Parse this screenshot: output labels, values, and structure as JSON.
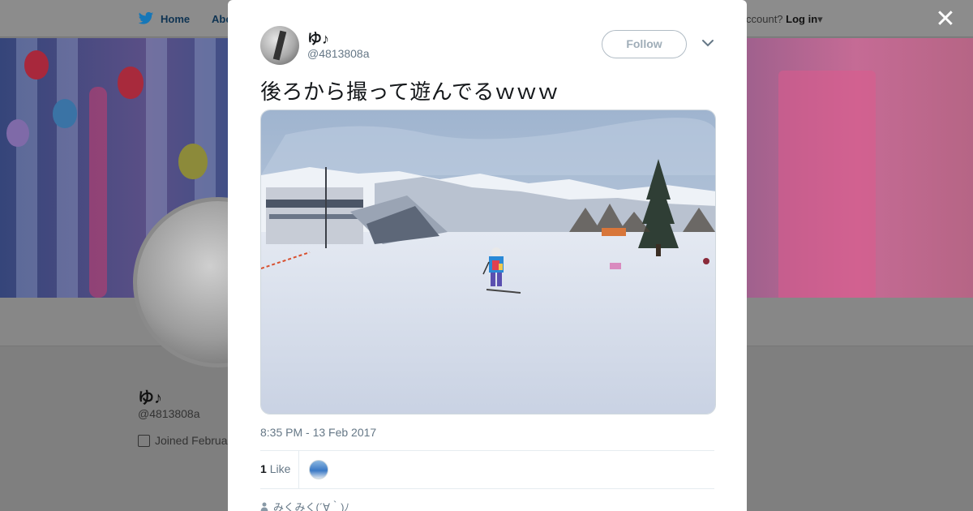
{
  "background": {
    "nav": {
      "home_label": "Home",
      "about_label": "Abo",
      "account_prefix": "ccount?",
      "login_label": "Log in"
    },
    "profile": {
      "name": "ゆ♪",
      "handle": "@4813808a",
      "joined": "Joined Februa"
    }
  },
  "modal": {
    "author": {
      "name": "ゆ♪",
      "handle": "@4813808a"
    },
    "follow_label": "Follow",
    "tweet_text": "後ろから撮って遊んでるｗｗｗ",
    "timestamp": "8:35 PM - 13 Feb 2017",
    "likes": {
      "count": "1",
      "label": "Like"
    },
    "reply_preview": "みくみく(´∀｀)ﾉ"
  },
  "icons": {
    "close": "close-icon",
    "chevron": "chevron-down-icon",
    "bird": "twitter-bird-icon",
    "calendar": "calendar-icon",
    "person": "person-icon"
  },
  "colors": {
    "overlay": "#7f7f7f",
    "brand_blue": "#1da1f2",
    "muted_text": "#657786",
    "follow_border": "#b1bcc5"
  }
}
